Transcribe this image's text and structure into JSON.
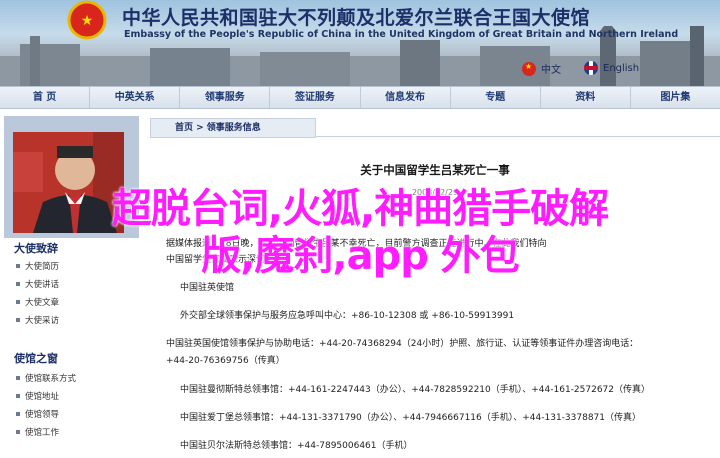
{
  "banner": {
    "title_cn": "中华人民共和国驻大不列颠及北爱尔兰联合王国大使馆",
    "title_en": "Embassy of the People's Republic of China in the United Kingdom of Great Britain and Northern Ireland",
    "lang_cn": "中文",
    "lang_en": "English"
  },
  "nav": {
    "items": [
      "首 页",
      "中英关系",
      "领事服务",
      "签证服务",
      "信息发布",
      "专题",
      "资料",
      "图片集"
    ]
  },
  "sidebar": {
    "section1_title": "大使致辞",
    "section1_items": [
      "大使简历",
      "大使讲话",
      "大使文章",
      "大使采访"
    ],
    "section2_title": "使馆之窗",
    "section2_items": [
      "使馆联系方式",
      "使馆地址",
      "使馆领导",
      "使馆工作"
    ]
  },
  "main": {
    "breadcrumb": "首页 > 领事服务信息",
    "article_title": "关于中国留学生吕某死亡一事",
    "article_date": "2008/12/29",
    "body_lines": [
      "据媒体报道，28日晚，在英中国留学生吕某不幸死亡，目前警方调查正在进行中。在此我们特向",
      "中国留学生家属表示深切慰问。",
      "中国驻英使馆",
      "外交部全球领事保护与服务应急呼叫中心：+86-10-12308 或 +86-10-59913991",
      "中国驻英国使馆领事保护与协助电话：+44-20-74368294（24小时）护照、旅行证、认证等领事证件办理咨询电话：",
      "+44-20-76369756（传真）",
      "中国驻曼彻斯特总领事馆：+44-161-2247443（办公）、+44-7828592210（手机）、+44-161-2572672（传真）",
      "中国驻爱丁堡总领事馆：+44-131-3371790（办公）、+44-7946667116（手机）、+44-131-3378871（传真）",
      "中国驻贝尔法斯特总领事馆：+44-7895006461（手机）"
    ]
  },
  "overlay": {
    "line1": "超脱台词,火狐,神曲猎手破解",
    "line2": "版,魔刹,app 外包"
  },
  "colors": {
    "nav_text": "#1f3a73",
    "overlay_text": "#ff1cff",
    "banner_title": "#1c2f66"
  }
}
